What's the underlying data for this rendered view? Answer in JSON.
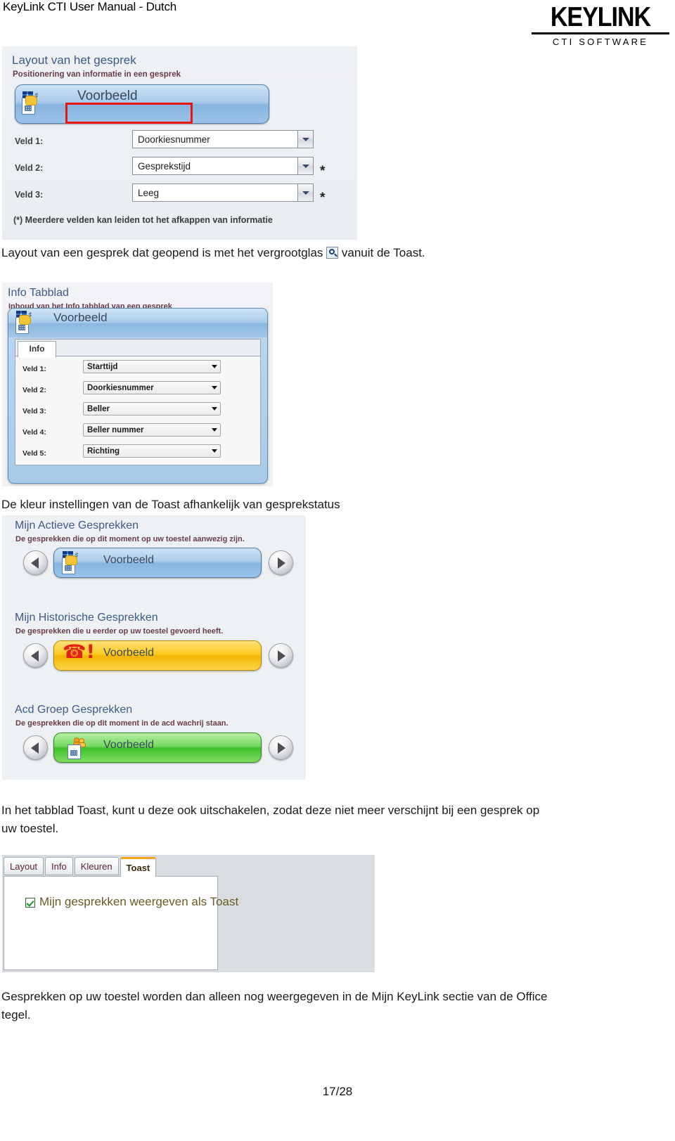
{
  "header": {
    "doc_title": "KeyLink CTI User Manual - Dutch",
    "logo_word": "KEYLINK",
    "logo_sub": "CTI SOFTWARE"
  },
  "layout_panel": {
    "title": "Layout van het gesprek",
    "subtitle": "Positionering van informatie in een gesprek",
    "preview_label": "Voorbeeld",
    "fields": [
      {
        "label": "Veld 1:",
        "value": "Doorkiesnummer",
        "asterisk": ""
      },
      {
        "label": "Veld 2:",
        "value": "Gesprekstijd",
        "asterisk": "*"
      },
      {
        "label": "Veld 3:",
        "value": "Leeg",
        "asterisk": "*"
      }
    ],
    "footnote": "(*) Meerdere velden kan leiden tot het afkappen van informatie"
  },
  "caption_1": {
    "before": "Layout van een gesprek dat geopend is met het vergrootglas",
    "icon": "magnifier-icon",
    "after": "vanuit de Toast."
  },
  "info_panel": {
    "title": "Info Tabblad",
    "subtitle": "Inhoud van het Info tabblad van een gesprek",
    "preview_label": "Voorbeeld",
    "tab_label": "Info",
    "fields": [
      {
        "label": "Veld 1:",
        "value": "Starttijd"
      },
      {
        "label": "Veld 2:",
        "value": "Doorkiesnummer"
      },
      {
        "label": "Veld 3:",
        "value": "Beller"
      },
      {
        "label": "Veld 4:",
        "value": "Beller nummer"
      },
      {
        "label": "Veld 5:",
        "value": "Richting"
      }
    ]
  },
  "caption_2": "De kleur instellingen van de Toast afhankelijk van gesprekstatus",
  "colors_panel": {
    "sections": [
      {
        "title": "Mijn Actieve Gesprekken",
        "subtitle": "De gesprekken die op dit moment op uw toestel aanwezig zijn.",
        "toast_label": "Voorbeeld",
        "toast_color": "#86b4df",
        "icon": "call-phone-icon",
        "prev": "prev-arrow-icon",
        "next": "next-arrow-icon"
      },
      {
        "title": "Mijn Historische Gesprekken",
        "subtitle": "De gesprekken die u eerder op uw toestel gevoerd heeft.",
        "toast_label": "Voorbeeld",
        "toast_color": "#f2b505",
        "icon": "missed-call-icon",
        "prev": "prev-arrow-icon",
        "next": "next-arrow-icon"
      },
      {
        "title": "Acd Groep Gesprekken",
        "subtitle": "De gesprekken die op dit moment in de acd wachrij staan.",
        "toast_label": "Voorbeeld",
        "toast_color": "#3fbf2a",
        "icon": "acd-group-icon",
        "prev": "prev-arrow-icon",
        "next": "next-arrow-icon"
      }
    ]
  },
  "paragraph_1": {
    "line1": "In het tabblad Toast, kunt u deze ook uitschakelen, zodat deze niet meer verschijnt bij een gesprek op",
    "line2": "uw toestel."
  },
  "toast_panel": {
    "tabs": [
      {
        "label": "Layout",
        "active": false
      },
      {
        "label": "Info",
        "active": false
      },
      {
        "label": "Kleuren",
        "active": false
      },
      {
        "label": "Toast",
        "active": true
      }
    ],
    "checkbox_label": "Mijn gesprekken weergeven als Toast",
    "checkbox_checked": true,
    "accent_color": "#f0a21b"
  },
  "paragraph_2": {
    "line1": "Gesprekken op uw toestel worden dan alleen nog weergegeven in de Mijn KeyLink sectie van de Office",
    "line2": "tegel."
  },
  "footer": {
    "page": "17/28"
  }
}
